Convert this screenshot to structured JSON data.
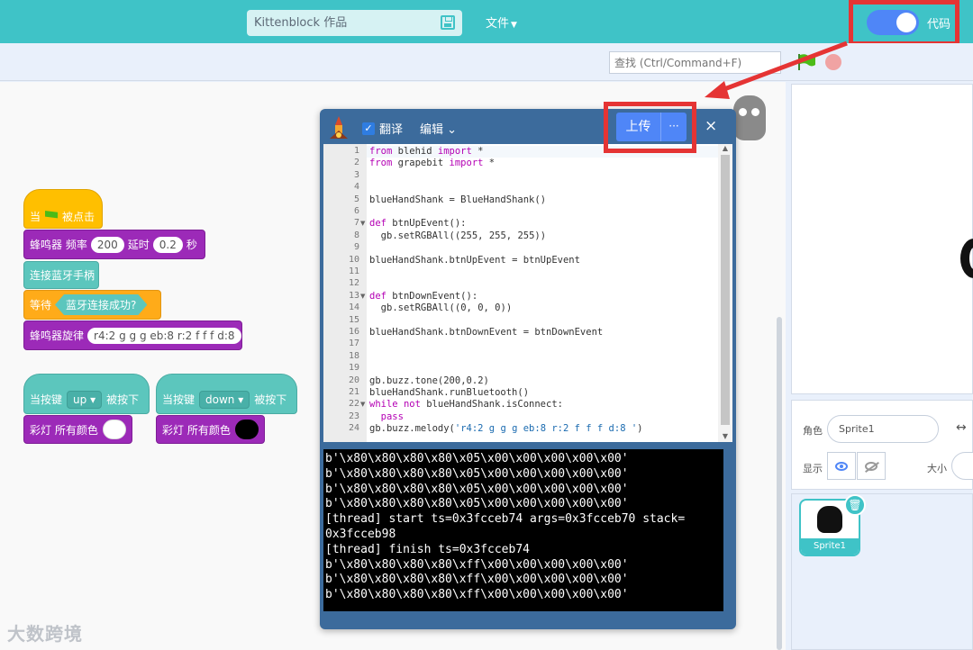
{
  "header": {
    "project_name": "Kittenblock 作品",
    "file_menu": "文件",
    "mode_label": "代码"
  },
  "toolbar": {
    "search_placeholder": "查找 (Ctrl/Command+F)"
  },
  "blocks": {
    "when_flag_clicked": {
      "prefix": "当",
      "suffix": "被点击"
    },
    "buzzer": {
      "label": "蜂鸣器 频率",
      "freq": "200",
      "delay_label": "延时",
      "delay": "0.2",
      "unit": "秒"
    },
    "connect_bt": "连接蓝牙手柄",
    "wait": {
      "label": "等待",
      "condition": "蓝牙连接成功?"
    },
    "melody": {
      "label": "蜂鸣器旋律",
      "value": "r4:2 g g g eb:8 r:2 f f f d:8"
    },
    "on_up": {
      "label": "当按键",
      "key": "up",
      "suffix": "被按下"
    },
    "on_down": {
      "label": "当按键",
      "key": "down",
      "suffix": "被按下"
    },
    "led_up": {
      "label": "彩灯 所有颜色",
      "color": "#ffffff"
    },
    "led_down": {
      "label": "彩灯 所有颜色",
      "color": "#000000"
    }
  },
  "dialog": {
    "translate_label": "翻译",
    "translate_checked": true,
    "edit_menu": "编辑",
    "upload_label": "上传",
    "more_label": "···",
    "close_label": "×",
    "code_lines": [
      "from blehid import *",
      "from grapebit import *",
      "",
      "",
      "blueHandShank = BlueHandShank()",
      "",
      "def btnUpEvent():",
      "  gb.setRGBAll((255, 255, 255))",
      "",
      "blueHandShank.btnUpEvent = btnUpEvent",
      "",
      "",
      "def btnDownEvent():",
      "  gb.setRGBAll((0, 0, 0))",
      "",
      "blueHandShank.btnDownEvent = btnDownEvent",
      "",
      "",
      "",
      "gb.buzz.tone(200,0.2)",
      "blueHandShank.runBluetooth()",
      "while not blueHandShank.isConnect:",
      "  pass",
      "gb.buzz.melody('r4:2 g g g eb:8 r:2 f f f d:8 ')"
    ],
    "fold_lines": [
      7,
      13,
      22
    ],
    "console": "b'\\x80\\x80\\x80\\x80\\x05\\x00\\x00\\x00\\x00\\x00'\nb'\\x80\\x80\\x80\\x80\\x05\\x00\\x00\\x00\\x00\\x00'\nb'\\x80\\x80\\x80\\x80\\x05\\x00\\x00\\x00\\x00\\x00'\nb'\\x80\\x80\\x80\\x80\\x05\\x00\\x00\\x00\\x00\\x00'\n[thread] start ts=0x3fcceb74 args=0x3fcceb70 stack=\n0x3fcceb98\n[thread] finish ts=0x3fcceb74\nb'\\x80\\x80\\x80\\x80\\xff\\x00\\x00\\x00\\x00\\x00'\nb'\\x80\\x80\\x80\\x80\\xff\\x00\\x00\\x00\\x00\\x00'\nb'\\x80\\x80\\x80\\x80\\xff\\x00\\x00\\x00\\x00\\x00'"
  },
  "sprite_panel": {
    "sprite_label": "角色",
    "sprite_name": "Sprite1",
    "show_label": "显示",
    "size_label": "大小",
    "card_name": "Sprite1"
  },
  "watermark": "大数跨境",
  "colors": {
    "topbar": "#3fc3c7",
    "accent": "#4f86f7",
    "highlight": "#e53434"
  }
}
